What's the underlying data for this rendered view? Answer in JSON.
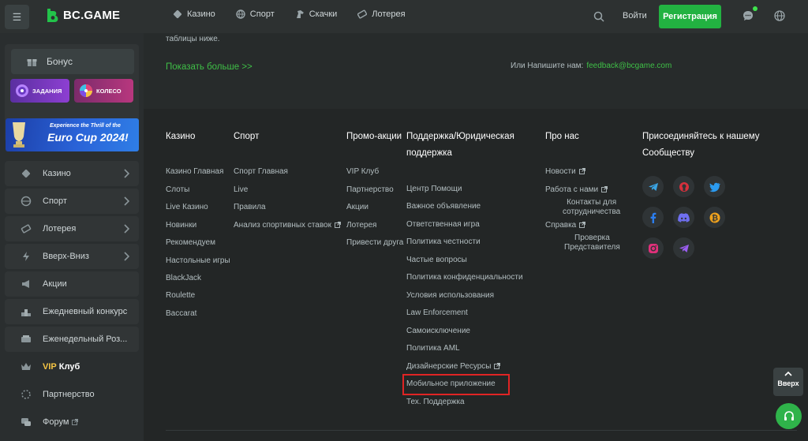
{
  "topbar": {
    "menu_icon": "☰",
    "logo_text": "BC.GAME",
    "nav": [
      {
        "label": "Казино",
        "icon": "casino-icon"
      },
      {
        "label": "Спорт",
        "icon": "sport-icon"
      },
      {
        "label": "Скачки",
        "icon": "horse-racing-icon"
      },
      {
        "label": "Лотерея",
        "icon": "lottery-icon"
      }
    ],
    "login_label": "Войти",
    "register_label": "Регистрация",
    "accent_color": "#22b241"
  },
  "sidebar": {
    "bonus_label": "Бонус",
    "tasks_label": "ЗАДАНИЯ",
    "wheel_label": "КОЛЕСО",
    "promo_small": "Experience the Thrill of the",
    "promo_big": "Euro Cup 2024!",
    "items": [
      {
        "label": "Казино"
      },
      {
        "label": "Спорт"
      },
      {
        "label": "Лотерея"
      },
      {
        "label": "Вверх-Вниз"
      },
      {
        "label": "Акции"
      },
      {
        "label": "Ежедневный конкурс"
      },
      {
        "label": "Еженедельный Роз..."
      }
    ],
    "vip_gold": "VIP",
    "vip_white": "Клуб",
    "partnership_label": "Партнерство",
    "forum_label": "Форум"
  },
  "main": {
    "top_text": "таблицы ниже.",
    "show_more": "Показать больше >>",
    "contact_label": "Или Напишите нам:",
    "contact_email": "feedback@bcgame.com"
  },
  "footer": {
    "casino": {
      "title": "Казино",
      "links": [
        "Казино Главная",
        "Слоты",
        "Live Казино",
        "Новинки",
        "Рекомендуем",
        "Настольные игры",
        "BlackJack",
        "Roulette",
        "Baccarat"
      ]
    },
    "sport": {
      "title": "Спорт",
      "links": [
        "Спорт Главная",
        "Live",
        "Правила",
        "Анализ спортивных ставок"
      ]
    },
    "promo": {
      "title": "Промо-акции",
      "links": [
        "VIP Клуб",
        "Партнерство",
        "Акции",
        "Лотерея",
        "Привести друга"
      ]
    },
    "support": {
      "title_line1": "Поддержка/Юридическая",
      "title_line2": "поддержка",
      "links": [
        "Центр Помощи",
        "Важное объявление",
        "Ответственная игра",
        "Политика честности",
        "Частые вопросы",
        "Политика конфиденциальности",
        "Условия использования",
        "Law Enforcement",
        "Самоисключение",
        "Политика AML",
        "Дизайнерские Ресурсы",
        "Мобильное приложение",
        "Тех. Поддержка"
      ]
    },
    "about": {
      "title": "Про нас",
      "news": "Новости",
      "jobs": "Работа с нами",
      "contacts_line1": "Контакты для",
      "contacts_line2": "сотрудничества",
      "help": "Справка",
      "verify_line1": "Проверка",
      "verify_line2": "Представителя"
    },
    "community": {
      "title_line1": "Присоединяйтесь к нашему",
      "title_line2": "Сообществу",
      "socials": [
        "telegram-icon",
        "github-icon",
        "twitter-icon",
        "facebook-icon",
        "discord-icon",
        "bitcoin-icon",
        "instagram-icon",
        "telegram-channel-icon"
      ]
    }
  },
  "float": {
    "up_label": "Вверх"
  }
}
